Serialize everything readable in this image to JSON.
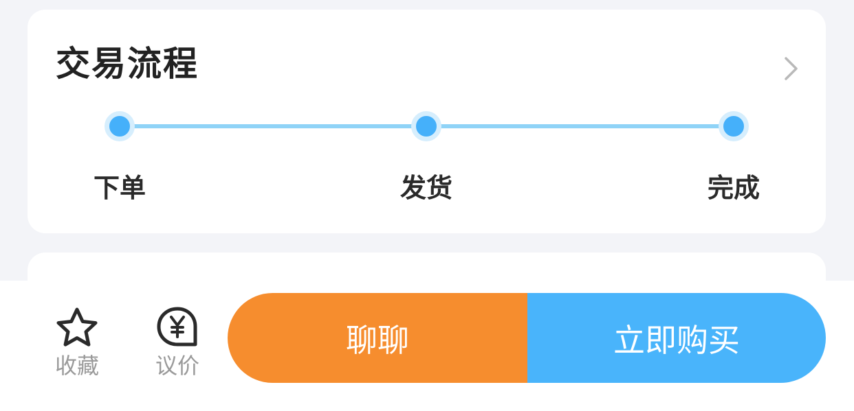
{
  "process": {
    "title": "交易流程",
    "steps": [
      {
        "label": "下单"
      },
      {
        "label": "发货"
      },
      {
        "label": "完成"
      }
    ]
  },
  "bottom_bar": {
    "favorite_label": "收藏",
    "negotiate_label": "议价",
    "chat_label": "聊聊",
    "buy_label": "立即购买"
  },
  "colors": {
    "chat_button": "#f68d2e",
    "buy_button": "#49b4fb",
    "step_dot": "#45b0fa",
    "track": "#8fd3f7"
  },
  "icons": {
    "chevron": "chevron-right-icon",
    "favorite": "star-icon",
    "negotiate": "yen-bubble-icon"
  }
}
